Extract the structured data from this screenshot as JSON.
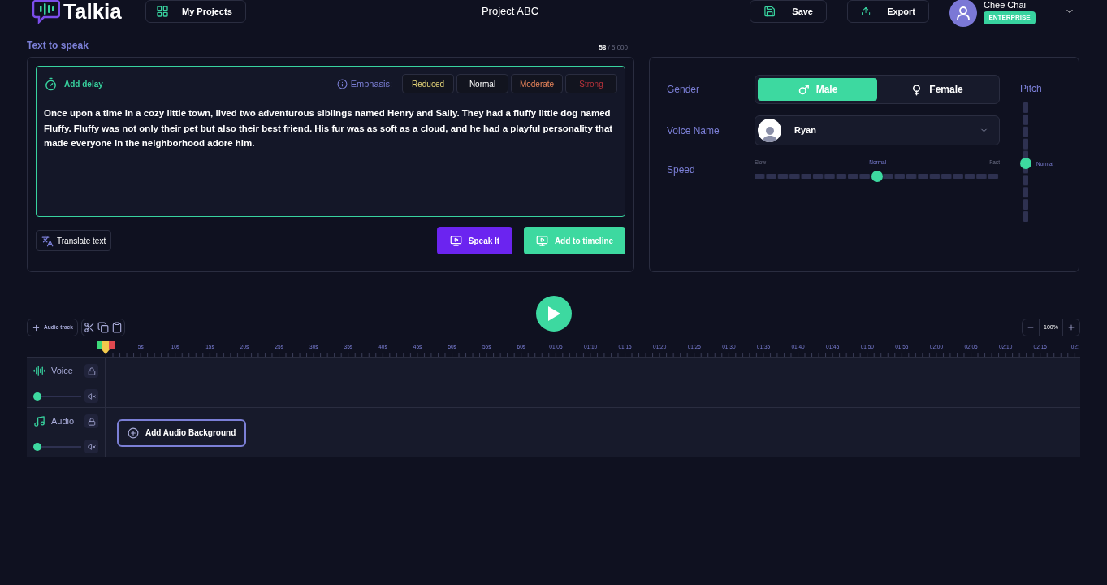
{
  "header": {
    "logo": "Talkia",
    "projects_button": "My Projects",
    "project_title": "Project ABC",
    "save_button": "Save",
    "export_button": "Export",
    "user": {
      "name": "Chee Chai",
      "plan": "ENTERPRISE"
    }
  },
  "text_panel": {
    "title": "Text to speak",
    "count": "58",
    "limit": "/ 5,000",
    "add_delay": "Add delay",
    "emphasis_label": "Emphasis:",
    "emphasis_options": [
      {
        "label": "Reduced",
        "color": "#e8d77a"
      },
      {
        "label": "Normal",
        "color": "#ffffff"
      },
      {
        "label": "Moderate",
        "color": "#e8845a"
      },
      {
        "label": "Strong",
        "color": "#b8323a"
      }
    ],
    "text": "Once upon a time in a cozy little town, lived two adventurous siblings named Henry and Sally. They had a fluffy little dog named Fluffy. Fluffy was not only their pet but also their best friend. His fur was as soft as a cloud, and he had a playful personality that made everyone in the neighborhood adore him.",
    "translate_button": "Translate text",
    "speak_button": "Speak It",
    "timeline_button": "Add to timeline"
  },
  "voice_panel": {
    "gender_label": "Gender",
    "genders": [
      {
        "label": "Male",
        "kind": "male",
        "selected": true
      },
      {
        "label": "Female",
        "kind": "female",
        "selected": false
      }
    ],
    "voice_label": "Voice Name",
    "voice": "Ryan",
    "speed_label": "Speed",
    "speed": {
      "min_label": "Slow",
      "mid_label": "Normal",
      "max_label": "Fast",
      "level": 0.5
    },
    "pitch_label": "Pitch",
    "pitch": {
      "reading": "Normal",
      "level": 0.5
    }
  },
  "timeline": {
    "add_track": "Audio track",
    "zoom": "100%",
    "ruler": [
      "5s",
      "10s",
      "15s",
      "20s",
      "25s",
      "30s",
      "35s",
      "40s",
      "45s",
      "50s",
      "55s",
      "60s",
      "01:05",
      "01:10",
      "01:15",
      "01:20",
      "01:25",
      "01:30",
      "01:35",
      "01:40",
      "01:45",
      "01:50",
      "01:55",
      "02:00",
      "02:05",
      "02:10",
      "02:15",
      "02:"
    ],
    "tracks": [
      {
        "name": "Voice",
        "kind": "voice",
        "level": 0
      },
      {
        "name": "Audio",
        "kind": "audio",
        "level": 0
      }
    ],
    "add_background": "Add Audio Background"
  }
}
